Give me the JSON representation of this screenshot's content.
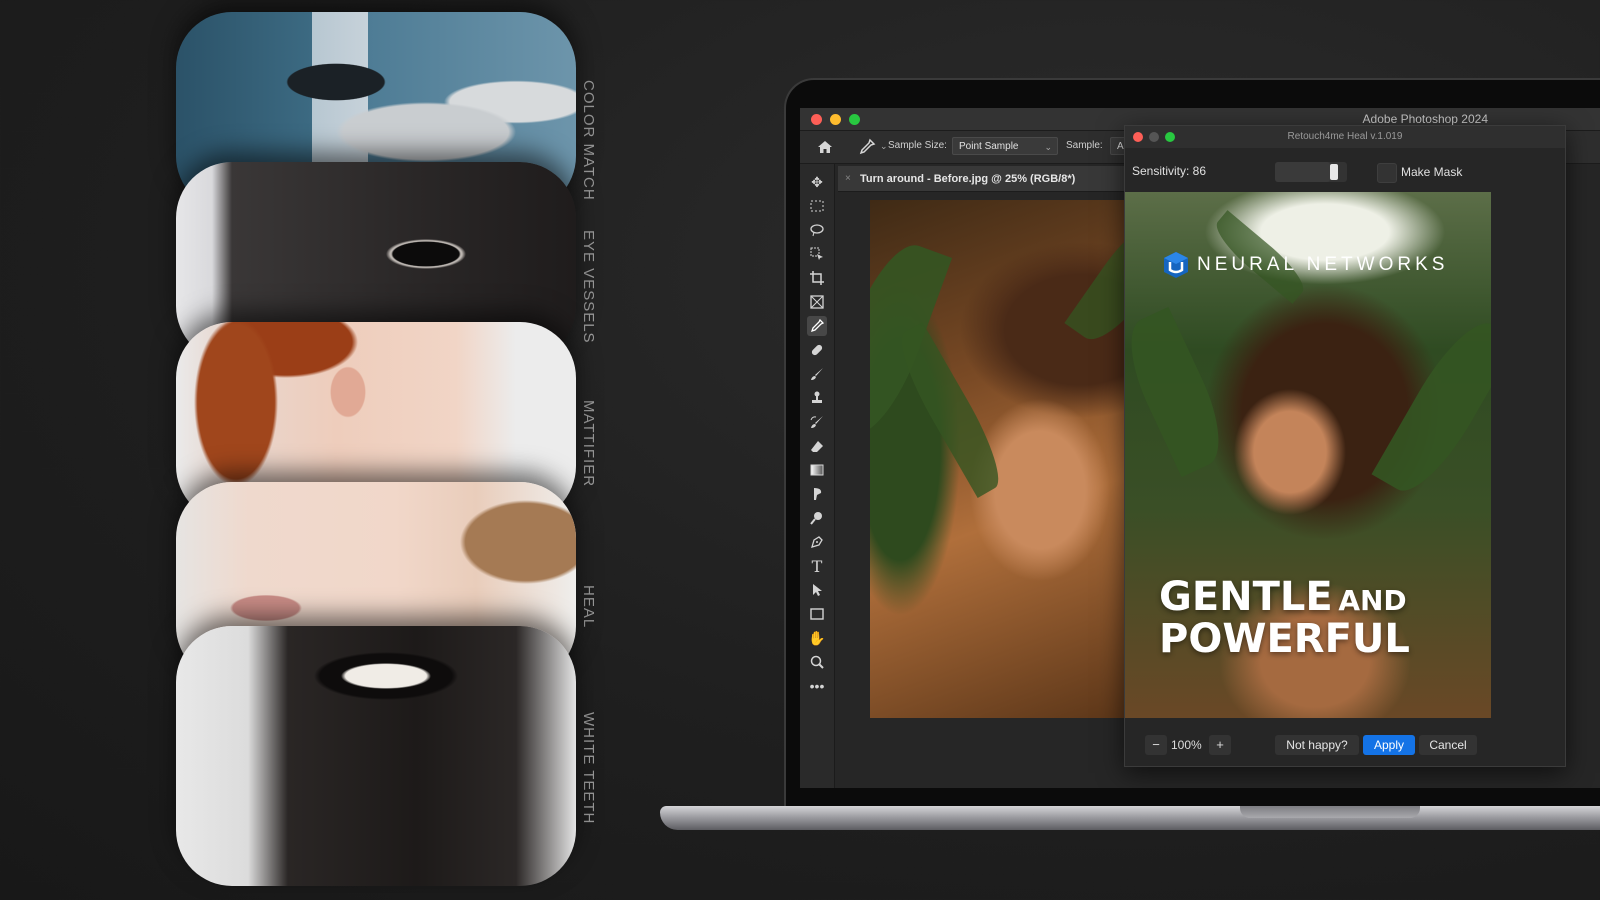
{
  "features": {
    "labels": [
      "COLOR MATCH",
      "EYE VESSELS",
      "MATTIFIER",
      "HEAL",
      "WHITE TEETH"
    ]
  },
  "photoshop": {
    "app_title": "Adobe Photoshop 2024",
    "options": {
      "sample_size_label": "Sample Size:",
      "sample_size_value": "Point Sample",
      "sample_label": "Sample:",
      "sample_value": "Al"
    },
    "document_tab": "Turn around - Before.jpg @ 25% (RGB/8*)",
    "tools": [
      "move-tool",
      "marquee-tool",
      "lasso-tool",
      "object-select-tool",
      "crop-tool",
      "frame-tool",
      "eyedropper-tool",
      "healing-brush-tool",
      "brush-tool",
      "clone-stamp-tool",
      "history-brush-tool",
      "eraser-tool",
      "gradient-tool",
      "smudge-tool",
      "dodge-tool",
      "pen-tool",
      "type-tool",
      "path-select-tool",
      "rectangle-tool",
      "hand-tool",
      "zoom-tool",
      "more-tools"
    ]
  },
  "plugin": {
    "title": "Retouch4me Heal v.1.019",
    "sensitivity_label": "Sensitivity: 86",
    "sensitivity_value": 86,
    "make_mask_label": "Make Mask",
    "brand_text": "NEURAL NETWORKS",
    "headline": {
      "line1_a": "GENTLE",
      "line1_b": "AND",
      "line2": "POWERFUL"
    },
    "zoom_minus": "−",
    "zoom_value": "100%",
    "zoom_plus": "+",
    "not_happy_label": "Not happy?",
    "apply_label": "Apply",
    "cancel_label": "Cancel",
    "accent_color": "#1473e6"
  }
}
